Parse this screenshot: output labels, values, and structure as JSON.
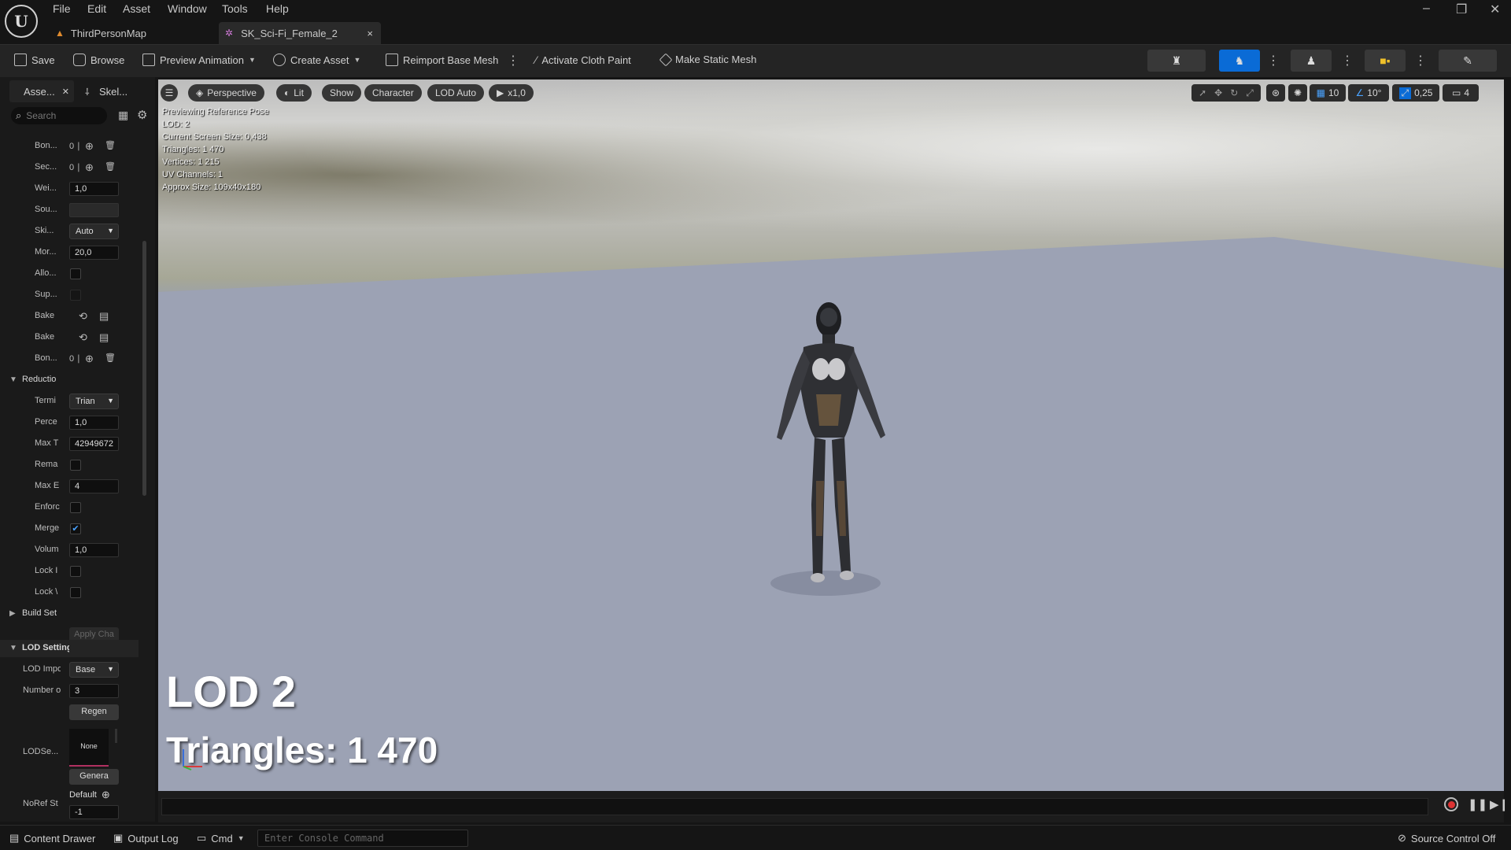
{
  "app": {
    "logo": "unreal-engine-logo"
  },
  "menu": [
    "File",
    "Edit",
    "Asset",
    "Window",
    "Tools",
    "Help"
  ],
  "tabs": [
    {
      "label": "ThirdPersonMap",
      "icon": "map-icon"
    },
    {
      "label": "SK_Sci-Fi_Female_2",
      "icon": "skeletal-mesh-icon",
      "close": "×"
    }
  ],
  "window_controls": {
    "minimize": "–",
    "maximize": "❐",
    "close": "✕"
  },
  "toolbar": {
    "save": "Save",
    "browse": "Browse",
    "preview_animation": "Preview Animation",
    "create_asset": "Create Asset",
    "reimport": "Reimport Base Mesh",
    "cloth_paint": "Activate Cloth Paint",
    "static_mesh": "Make Static Mesh"
  },
  "left_panel": {
    "tabs": [
      {
        "label": "Asse..."
      },
      {
        "label": "Skel..."
      }
    ],
    "search_placeholder": "Search",
    "rows": [
      {
        "label": "Bon...",
        "type": "array",
        "value": "0 ∣"
      },
      {
        "label": "Sec...",
        "type": "array",
        "value": "0 ∣"
      },
      {
        "label": "Wei...",
        "type": "field",
        "value": "1,0"
      },
      {
        "label": "Sou...",
        "type": "field",
        "value": ""
      },
      {
        "label": "Ski...",
        "type": "dropdown",
        "value": "Auto"
      },
      {
        "label": "Mor...",
        "type": "field",
        "value": "20,0"
      },
      {
        "label": "Allo...",
        "type": "checkbox",
        "value": ""
      },
      {
        "label": "Sup...",
        "type": "checkbox",
        "value": ""
      },
      {
        "label": "Bake",
        "type": "bake",
        "value": ""
      },
      {
        "label": "Bake",
        "type": "bake",
        "value": ""
      },
      {
        "label": "Bon...",
        "type": "array",
        "value": "0 ∣"
      },
      {
        "label": "Reductio",
        "type": "section",
        "value": ""
      },
      {
        "label": "Termi",
        "type": "dropdown",
        "value": "Trian"
      },
      {
        "label": "Perce",
        "type": "field",
        "value": "1,0"
      },
      {
        "label": "Max T",
        "type": "field",
        "value": "42949672"
      },
      {
        "label": "Rema",
        "type": "checkbox",
        "value": ""
      },
      {
        "label": "Max E",
        "type": "field",
        "value": "4"
      },
      {
        "label": "Enforc",
        "type": "checkbox",
        "value": ""
      },
      {
        "label": "Merge",
        "type": "checkbox",
        "value": "✔"
      },
      {
        "label": "Volum",
        "type": "field",
        "value": "1,0"
      },
      {
        "label": "Lock I",
        "type": "checkbox",
        "value": ""
      },
      {
        "label": "Lock \\",
        "type": "checkbox",
        "value": ""
      },
      {
        "label": "Build Set",
        "type": "collapsed",
        "value": ""
      }
    ],
    "apply_changes": "Apply Cha",
    "lod_settings": {
      "header": "LOD Settings",
      "lod_import_label": "LOD Impo",
      "lod_import_value": "Base",
      "number_label": "Number o",
      "number_value": "3",
      "regen": "Regen",
      "lodse_label": "LODSe...",
      "thumb_text": "None",
      "generate": "Genera",
      "noref_label": "NoRef St",
      "default": "Default",
      "noref_value": "-1"
    }
  },
  "viewport": {
    "menu_icon": "hamburger-icon",
    "perspective": "Perspective",
    "lit": "Lit",
    "show": "Show",
    "character": "Character",
    "lod": "LOD Auto",
    "speed": "x1,0",
    "right_tools": {
      "grid": "10",
      "angle": "10°",
      "scale": "0,25",
      "camera": "4"
    },
    "stats": [
      "Previewing Reference Pose",
      "LOD: 2",
      "Current Screen Size: 0,438",
      "Triangles: 1 470",
      "Vertices: 1 215",
      "UV Channels: 1",
      "Approx Size: 109x40x180"
    ],
    "lod_overlay": "LOD 2",
    "triangles_overlay": "Triangles: 1 470"
  },
  "status_bar": {
    "content_drawer": "Content Drawer",
    "output_log": "Output Log",
    "cmd": "Cmd",
    "console_placeholder": "Enter Console Command",
    "source_control": "Source Control Off"
  },
  "colors": {
    "accent": "#0a6bd6",
    "bg": "#151515",
    "panel": "#1a1a1a",
    "floor": "#9ca2b4"
  }
}
